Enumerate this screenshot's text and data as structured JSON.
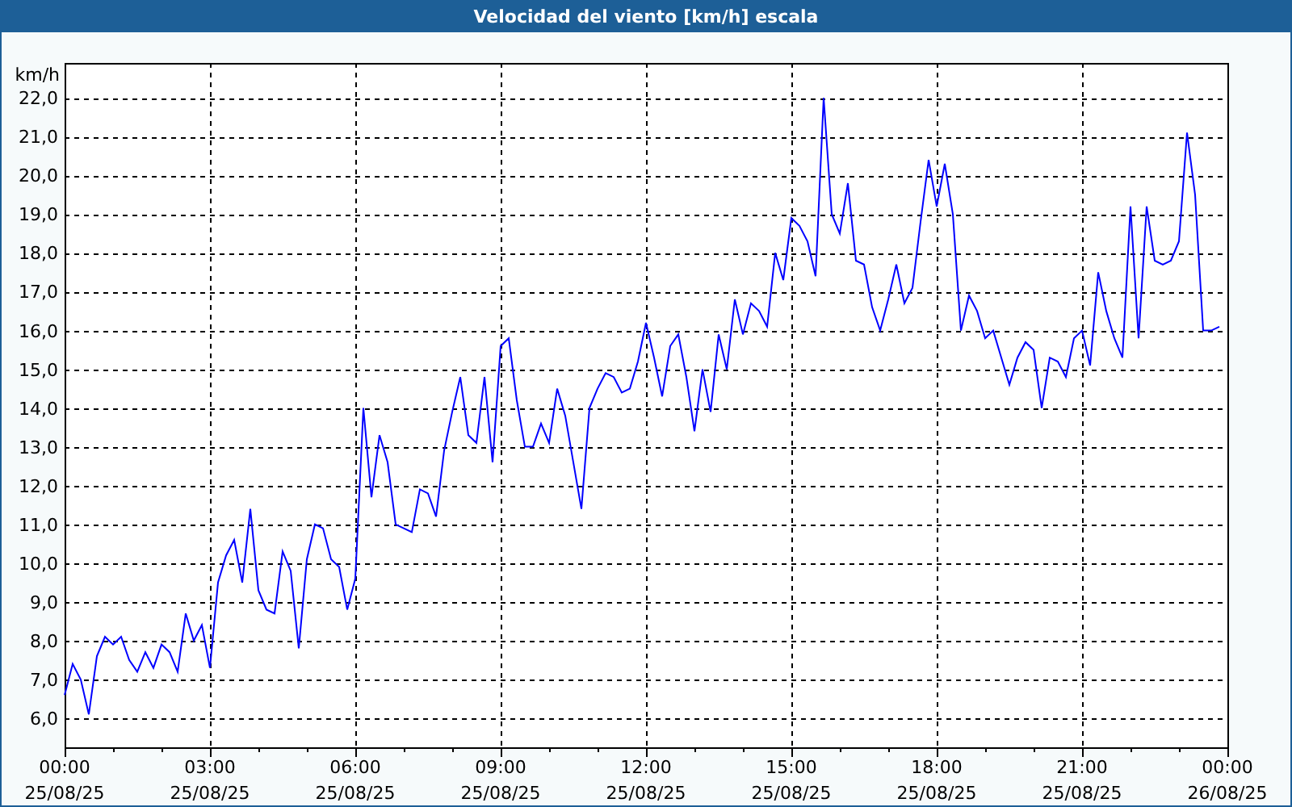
{
  "chart_data": {
    "type": "line",
    "title": "Velocidad del viento [km/h] escala",
    "ylabel": "km/h",
    "categories": [
      "00:00\n25/08/25",
      null,
      null,
      null,
      null,
      null,
      null,
      null,
      null,
      null,
      null,
      null,
      null,
      null,
      null,
      null,
      null,
      null,
      "03:00\n25/08/25",
      null,
      null,
      null,
      null,
      null,
      null,
      null,
      null,
      null,
      null,
      null,
      null,
      null,
      null,
      null,
      null,
      null,
      "06:00\n25/08/25",
      null,
      null,
      null,
      null,
      null,
      null,
      null,
      null,
      null,
      null,
      null,
      null,
      null,
      null,
      null,
      null,
      null,
      "09:00\n25/08/25",
      null,
      null,
      null,
      null,
      null,
      null,
      null,
      null,
      null,
      null,
      null,
      null,
      null,
      null,
      null,
      null,
      null,
      "12:00\n25/08/25",
      null,
      null,
      null,
      null,
      null,
      null,
      null,
      null,
      null,
      null,
      null,
      null,
      null,
      null,
      null,
      null,
      null,
      "15:00\n25/08/25",
      null,
      null,
      null,
      null,
      null,
      null,
      null,
      null,
      null,
      null,
      null,
      null,
      null,
      null,
      null,
      null,
      null,
      "18:00\n25/08/25",
      null,
      null,
      null,
      null,
      null,
      null,
      null,
      null,
      null,
      null,
      null,
      null,
      null,
      null,
      null,
      null,
      null,
      "21:00\n25/08/25",
      null,
      null,
      null,
      null,
      null,
      null,
      null,
      null,
      null,
      null,
      null,
      null,
      null,
      null,
      null,
      null,
      null,
      "00:00\n26/08/25"
    ],
    "series": [
      {
        "color": "#0000ff",
        "values": [
          6.6,
          7.4,
          7.0,
          6.1,
          7.6,
          8.1,
          7.9,
          8.1,
          7.5,
          7.2,
          7.7,
          7.3,
          7.9,
          7.7,
          7.2,
          8.7,
          8.0,
          8.4,
          7.3,
          9.5,
          10.2,
          10.6,
          9.5,
          11.4,
          9.3,
          8.8,
          8.7,
          10.3,
          9.8,
          7.8,
          10.1,
          11.0,
          10.9,
          10.1,
          9.9,
          8.8,
          9.6,
          14.0,
          11.7,
          13.3,
          12.6,
          11.0,
          10.9,
          10.8,
          11.9,
          11.8,
          11.2,
          12.9,
          13.9,
          14.8,
          13.3,
          13.1,
          14.8,
          12.6,
          15.6,
          15.8,
          14.2,
          13.0,
          13.0,
          13.6,
          13.1,
          14.5,
          13.8,
          12.6,
          11.4,
          14.0,
          14.5,
          14.9,
          14.8,
          14.4,
          14.5,
          15.2,
          16.2,
          15.3,
          14.3,
          15.6,
          15.9,
          14.8,
          13.4,
          15.0,
          13.9,
          15.9,
          15.0,
          16.8,
          15.9,
          16.7,
          16.5,
          16.1,
          18.0,
          17.3,
          18.9,
          18.7,
          18.3,
          17.4,
          22.0,
          19.0,
          18.5,
          19.8,
          17.8,
          17.7,
          16.6,
          16.0,
          16.8,
          17.7,
          16.7,
          17.1,
          18.8,
          20.4,
          19.2,
          20.3,
          19.0,
          16.0,
          16.9,
          16.5,
          15.8,
          16.0,
          15.3,
          14.6,
          15.3,
          15.7,
          15.5,
          14.0,
          15.3,
          15.2,
          14.8,
          15.8,
          16.0,
          15.1,
          17.5,
          16.5,
          15.8,
          15.3,
          19.2,
          15.8,
          19.2,
          17.8,
          17.7,
          17.8,
          18.3,
          21.1,
          19.5,
          16.0,
          16.0,
          16.1,
          null
        ]
      }
    ],
    "grid": true,
    "ylim": [
      5.25,
      22.9
    ],
    "yticks": [
      {
        "value": 6,
        "label": "6,0"
      },
      {
        "value": 7,
        "label": "7,0"
      },
      {
        "value": 8,
        "label": "8,0"
      },
      {
        "value": 9,
        "label": "9,0"
      },
      {
        "value": 10,
        "label": "10,0"
      },
      {
        "value": 11,
        "label": "11,0"
      },
      {
        "value": 12,
        "label": "12,0"
      },
      {
        "value": 13,
        "label": "13,0"
      },
      {
        "value": 14,
        "label": "14,0"
      },
      {
        "value": 15,
        "label": "15,0"
      },
      {
        "value": 16,
        "label": "16,0"
      },
      {
        "value": 17,
        "label": "17,0"
      },
      {
        "value": 18,
        "label": "18,0"
      },
      {
        "value": 19,
        "label": "19,0"
      },
      {
        "value": 20,
        "label": "20,0"
      },
      {
        "value": 21,
        "label": "21,0"
      },
      {
        "value": 22,
        "label": "22,0"
      }
    ]
  }
}
